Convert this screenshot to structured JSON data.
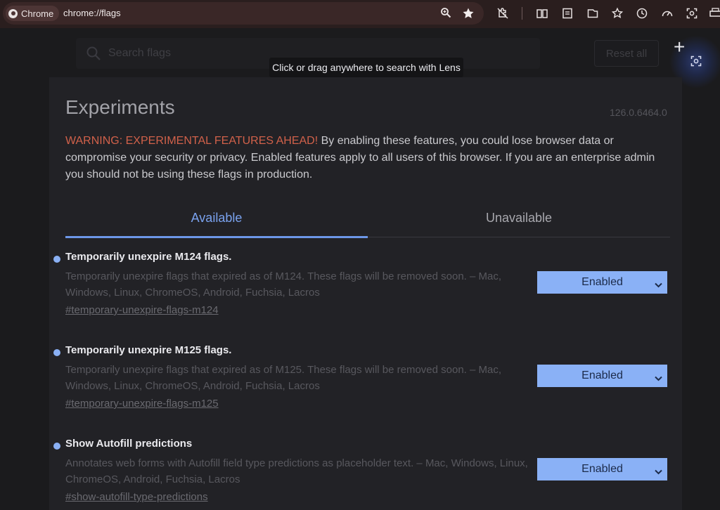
{
  "browser": {
    "chip_label": "Chrome",
    "url": "chrome://flags",
    "toolbar_icons": [
      "zoom-icon",
      "bookmark-star-icon",
      "extension-off-icon",
      "reading-mode-icon",
      "reading-list-icon",
      "tab-search-icon",
      "favorites-icon",
      "history-icon",
      "performance-icon",
      "lens-icon",
      "print-icon"
    ]
  },
  "search": {
    "placeholder": "Search flags"
  },
  "reset_label": "Reset all",
  "lens_tooltip": "Click or drag anywhere to search with Lens",
  "page": {
    "title": "Experiments",
    "version": "126.0.6464.0",
    "warning_prefix": "WARNING: EXPERIMENTAL FEATURES AHEAD!",
    "warning_body": " By enabling these features, you could lose browser data or compromise your security or privacy. Enabled features apply to all users of this browser. If you are an enterprise admin you should not be using these flags in production."
  },
  "tabs": [
    {
      "label": "Available",
      "active": true
    },
    {
      "label": "Unavailable",
      "active": false
    }
  ],
  "flags": [
    {
      "name": "Temporarily unexpire M124 flags.",
      "description": "Temporarily unexpire flags that expired as of M124. These flags will be removed soon. – Mac, Windows, Linux, ChromeOS, Android, Fuchsia, Lacros",
      "link": "#temporary-unexpire-flags-m124",
      "value": "Enabled"
    },
    {
      "name": "Temporarily unexpire M125 flags.",
      "description": "Temporarily unexpire flags that expired as of M125. These flags will be removed soon. – Mac, Windows, Linux, ChromeOS, Android, Fuchsia, Lacros",
      "link": "#temporary-unexpire-flags-m125",
      "value": "Enabled"
    },
    {
      "name": "Show Autofill predictions",
      "description": "Annotates web forms with Autofill field type predictions as placeholder text. – Mac, Windows, Linux, ChromeOS, Android, Fuchsia, Lacros",
      "link": "#show-autofill-type-predictions",
      "value": "Enabled"
    }
  ],
  "colors": {
    "accent": "#8ab1f6",
    "warning": "#d1614a",
    "background": "#1b1b1d",
    "card": "#222226"
  }
}
